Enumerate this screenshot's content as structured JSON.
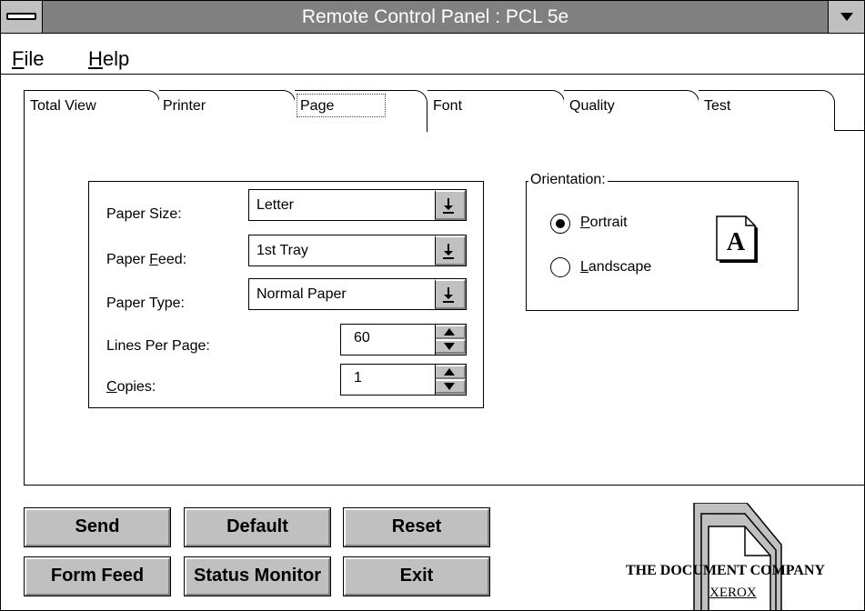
{
  "window": {
    "title": "Remote Control Panel : PCL 5e"
  },
  "menu": [
    {
      "key": "F",
      "rest": "ile"
    },
    {
      "key": "H",
      "rest": "elp"
    }
  ],
  "tabs": [
    "Total View",
    "Printer",
    "Page",
    "Font",
    "Quality",
    "Test"
  ],
  "active_tab": "Page",
  "paper": {
    "size_label": "Paper Size:",
    "size_value": "Letter",
    "feed_label_pre": "Paper ",
    "feed_label_key": "F",
    "feed_label_post": "eed:",
    "feed_value": "1st Tray",
    "type_label": "Paper Type:",
    "type_value": "Normal Paper",
    "lines_label": "Lines Per Page:",
    "lines_value": "60",
    "copies_label_key": "C",
    "copies_label_post": "opies:",
    "copies_value": "1"
  },
  "orientation": {
    "title": "Orientation:",
    "portrait_key": "P",
    "portrait_rest": "ortrait",
    "landscape_key": "L",
    "landscape_rest": "andscape",
    "selected": "Portrait",
    "icon_letter": "A"
  },
  "buttons": {
    "send": "Send",
    "default": "Default",
    "reset": "Reset",
    "form_feed": "Form Feed",
    "status_monitor": "Status Monitor",
    "exit": "Exit"
  },
  "branding": {
    "tagline": "THE DOCUMENT COMPANY",
    "company": "XEROX"
  },
  "colors": {
    "titlebar": "#808080",
    "button_face": "#c0c0c0"
  }
}
